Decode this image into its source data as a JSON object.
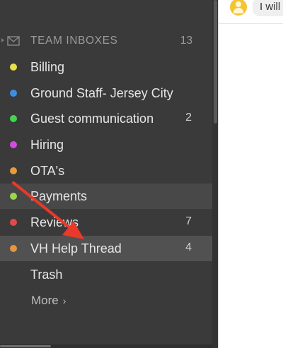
{
  "header": {
    "title": "TEAM INBOXES",
    "count": "13",
    "icon": "envelope-icon"
  },
  "items": [
    {
      "label": "Billing",
      "color": "#e8e04a",
      "count": ""
    },
    {
      "label": "Ground Staff- Jersey City",
      "color": "#3f8fe0",
      "count": ""
    },
    {
      "label": "Guest communication",
      "color": "#3fd84a",
      "count": "2"
    },
    {
      "label": "Hiring",
      "color": "#d44be0",
      "count": ""
    },
    {
      "label": "OTA's",
      "color": "#e89a3f",
      "count": ""
    },
    {
      "label": "Payments",
      "color": "#9ad84a",
      "count": ""
    },
    {
      "label": "Reviews",
      "color": "#e24a4a",
      "count": "7"
    },
    {
      "label": "VH Help Thread",
      "color": "#e8953a",
      "count": "4"
    }
  ],
  "trash": {
    "label": "Trash"
  },
  "more": {
    "label": "More",
    "chevron": "›"
  },
  "message": {
    "text": "I will"
  },
  "annotation": {
    "color": "#e8392b"
  }
}
